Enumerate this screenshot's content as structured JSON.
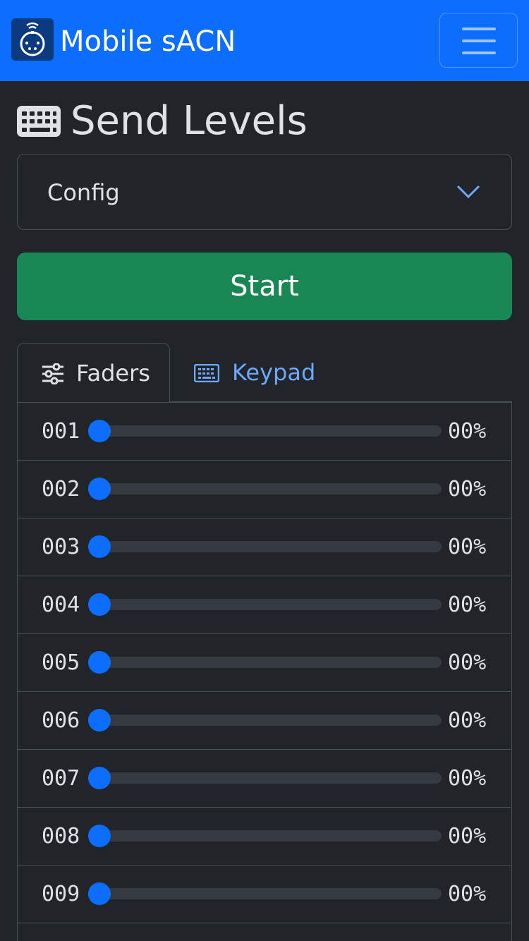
{
  "colors": {
    "navbar_bg": "#0d6efd",
    "page_bg": "#212529",
    "start_button_bg": "#198754",
    "accent_blue": "#0d6efd",
    "link_blue": "#6ea8fe"
  },
  "navbar": {
    "brand": "Mobile sACN",
    "logo_icon": "dmx-connector-logo",
    "menu_icon": "hamburger-icon"
  },
  "page": {
    "title": "Send Levels",
    "title_icon": "keyboard-icon"
  },
  "config_select": {
    "selected": "Config"
  },
  "start_button": {
    "label": "Start"
  },
  "tabs": [
    {
      "label": "Faders",
      "icon": "sliders-icon",
      "active": true
    },
    {
      "label": "Keypad",
      "icon": "keyboard-icon",
      "active": false
    }
  ],
  "faders": [
    {
      "channel": "001",
      "value_label": "00%",
      "level": 0
    },
    {
      "channel": "002",
      "value_label": "00%",
      "level": 0
    },
    {
      "channel": "003",
      "value_label": "00%",
      "level": 0
    },
    {
      "channel": "004",
      "value_label": "00%",
      "level": 0
    },
    {
      "channel": "005",
      "value_label": "00%",
      "level": 0
    },
    {
      "channel": "006",
      "value_label": "00%",
      "level": 0
    },
    {
      "channel": "007",
      "value_label": "00%",
      "level": 0
    },
    {
      "channel": "008",
      "value_label": "00%",
      "level": 0
    },
    {
      "channel": "009",
      "value_label": "00%",
      "level": 0
    }
  ]
}
